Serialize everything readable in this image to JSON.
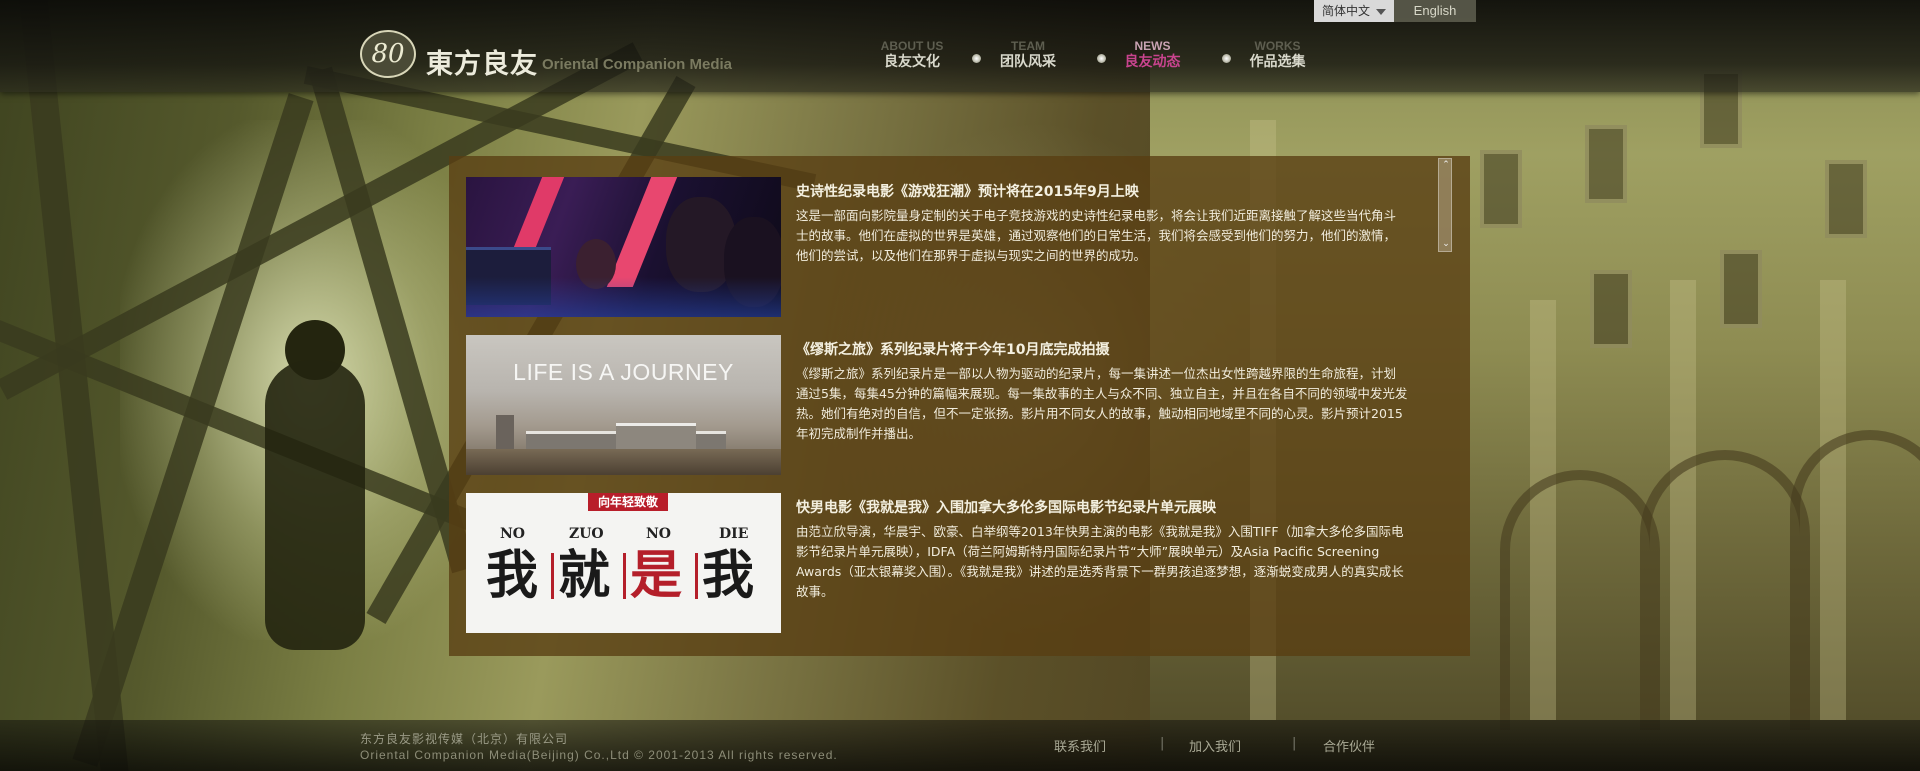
{
  "header": {
    "logo_mark": "80",
    "logo_cn": "東方良友",
    "logo_en": "Oriental Companion Media",
    "nav": [
      {
        "en": "ABOUT US",
        "cn": "良友文化",
        "active": false
      },
      {
        "en": "TEAM",
        "cn": "团队风采",
        "active": false
      },
      {
        "en": "NEWS",
        "cn": "良友动态",
        "active": true
      },
      {
        "en": "WORKS",
        "cn": "作品选集",
        "active": false
      }
    ],
    "language": {
      "current": "简体中文",
      "alternate": "English"
    }
  },
  "news": [
    {
      "title": "史诗性纪录电影《游戏狂潮》预计将在2015年9月上映",
      "body": "这是一部面向影院量身定制的关于电子竞技游戏的史诗性纪录电影，将会让我们近距离接触了解这些当代角斗士的故事。他们在虚拟的世界是英雄，通过观察他们的日常生活，我们将会感受到他们的努力，他们的激情，他们的尝试，以及他们在那界于虚拟与现实之间的世界的成功。",
      "thumb": "esports-thumbnail"
    },
    {
      "title": "《缪斯之旅》系列纪录片将于今年10月底完成拍摄",
      "body": "《缪斯之旅》系列纪录片是一部以人物为驱动的纪录片，每一集讲述一位杰出女性跨越界限的生命旅程，计划通过5集，每集45分钟的篇幅来展现。每一集故事的主人与众不同、独立自主，并且在各自不同的领域中发光发热。她们有绝对的自信，但不一定张扬。影片用不同女人的故事，触动相同地域里不同的心灵。影片预计2015年初完成制作并播出。",
      "thumb": "life-journey-thumbnail",
      "thumb_caption": "LIFE IS A JOURNEY"
    },
    {
      "title": "快男电影《我就是我》入围加拿大多伦多国际电影节纪录片单元展映",
      "body": "由范立欣导演，华晨宇、欧豪、白举纲等2013年快男主演的电影《我就是我》入围TIFF（加拿大多伦多国际电影节纪录片单元展映），IDFA（荷兰阿姆斯特丹国际纪录片节“大师”展映单元）及Asia Pacific Screening Awards（亚太银幕奖入围）。《我就是我》讲述的是选秀背景下一群男孩追逐梦想，逐渐蜕变成男人的真实成长故事。",
      "thumb": "no-zuo-no-die-poster",
      "poster_banner": "向年轻致敬",
      "poster_en": [
        "NO",
        "ZUO",
        "NO",
        "DIE"
      ],
      "poster_cn": [
        "我",
        "就",
        "是",
        "我"
      ]
    }
  ],
  "footer": {
    "company_cn": "东方良友影视传媒（北京）有限公司",
    "copyright": "Oriental Companion Media(Beijing) Co.,Ltd © 2001-2013 All rights reserved.",
    "links": [
      "联系我们",
      "加入我们",
      "合作伙伴"
    ],
    "separator": "|"
  },
  "colors": {
    "accent_active": "#c8448e",
    "panel": "#583e12",
    "poster_red": "#b41f2a"
  }
}
